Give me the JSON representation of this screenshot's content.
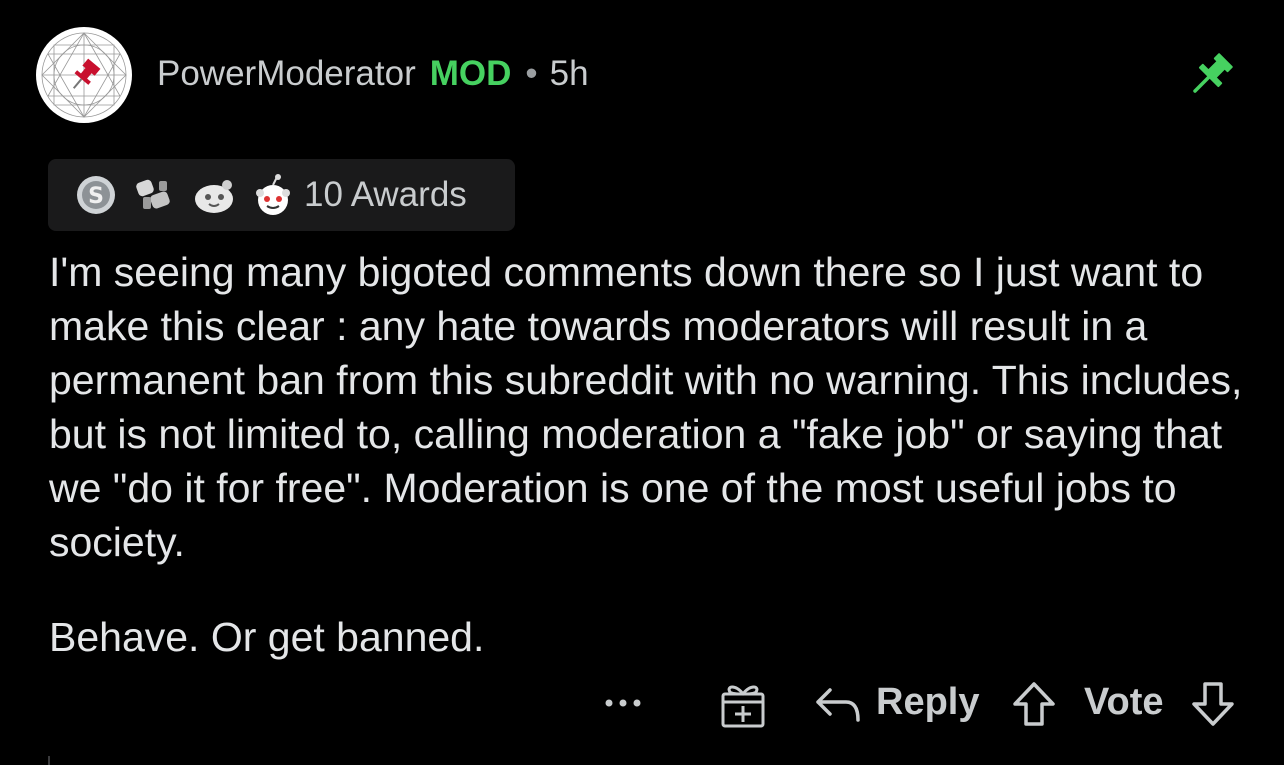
{
  "comment": {
    "username": "PowerModerator",
    "mod_badge": "MOD",
    "separator": "•",
    "time": "5h",
    "awards_label": "10 Awards",
    "body_paragraphs": [
      "I'm seeing many bigoted comments down there so I just want to make this clear : any hate towards moderators will result in a permanent ban from this subreddit with no warning. This includes, but is not limited to, calling moderation a \"fake job\" or saying that we \"do it for free\". Moderation is one of the most useful jobs to society.",
      "Behave. Or get banned."
    ]
  },
  "actions": {
    "more": "•••",
    "reply_label": "Reply",
    "vote_label": "Vote"
  },
  "colors": {
    "background": "#000000",
    "mod_green": "#46d160",
    "pin_green": "#46d160",
    "text": "#d7dadc",
    "award_bar_bg": "#1a1a1b"
  },
  "icons": {
    "avatar": "pin-on-geometric-pattern-avatar",
    "pinned": "pushpin-icon",
    "awards": [
      "silver-award-icon",
      "fist-bump-award-icon",
      "wholesome-award-icon",
      "snoo-award-icon"
    ],
    "more": "more-dots-icon",
    "gift": "gift-award-icon",
    "reply": "reply-arrow-icon",
    "upvote": "upvote-arrow-icon",
    "downvote": "downvote-arrow-icon"
  }
}
